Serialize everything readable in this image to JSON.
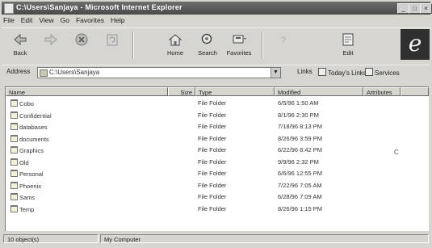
{
  "window": {
    "title": "C:\\Users\\Sanjaya - Microsoft Internet Explorer",
    "controls": [
      "_",
      "□",
      "×"
    ]
  },
  "menu": [
    "File",
    "Edit",
    "View",
    "Go",
    "Favorites",
    "Help"
  ],
  "toolbar": {
    "buttons": [
      {
        "label": "Back",
        "icon": "back-arrow-icon"
      },
      {
        "label": "",
        "icon": "forward-arrow-icon"
      },
      {
        "label": "",
        "icon": "stop-icon"
      },
      {
        "label": "",
        "icon": "refresh-icon"
      },
      {
        "label": "Home",
        "icon": "home-icon"
      },
      {
        "label": "Search",
        "icon": "search-icon"
      },
      {
        "label": "Favorites",
        "icon": "favorites-icon"
      },
      {
        "label": "",
        "icon": "history-icon"
      },
      {
        "label": "Edit",
        "icon": "edit-icon"
      }
    ]
  },
  "address": {
    "label": "Address",
    "value": "C:\\Users\\Sanjaya",
    "links": [
      "Links",
      "Today's Links",
      "Services"
    ]
  },
  "columns": [
    "Name",
    "Size",
    "Type",
    "Modified",
    "Attributes"
  ],
  "files": [
    {
      "name": "Cobo",
      "type": "File Folder",
      "modified": "6/5/96 1:50 AM"
    },
    {
      "name": "Confidential",
      "type": "File Folder",
      "modified": "8/1/96 2:30 PM"
    },
    {
      "name": "databases",
      "type": "File Folder",
      "modified": "7/18/96 8:13 PM"
    },
    {
      "name": "documents",
      "type": "File Folder",
      "modified": "8/26/96 3:59 PM"
    },
    {
      "name": "Graphics",
      "type": "File Folder",
      "modified": "6/22/96 8:42 PM"
    },
    {
      "name": "Old",
      "type": "File Folder",
      "modified": "9/9/96 2:32 PM"
    },
    {
      "name": "Personal",
      "type": "File Folder",
      "modified": "6/6/96 12:55 PM"
    },
    {
      "name": "Phoenix",
      "type": "File Folder",
      "modified": "7/22/96 7:05 AM"
    },
    {
      "name": "Sams",
      "type": "File Folder",
      "modified": "6/28/96 7:09 AM"
    },
    {
      "name": "Temp",
      "type": "File Folder",
      "modified": "8/26/96 1:15 PM"
    }
  ],
  "attr_marker": "C",
  "status": {
    "objects": "10 object(s)",
    "zone": "My Computer"
  }
}
